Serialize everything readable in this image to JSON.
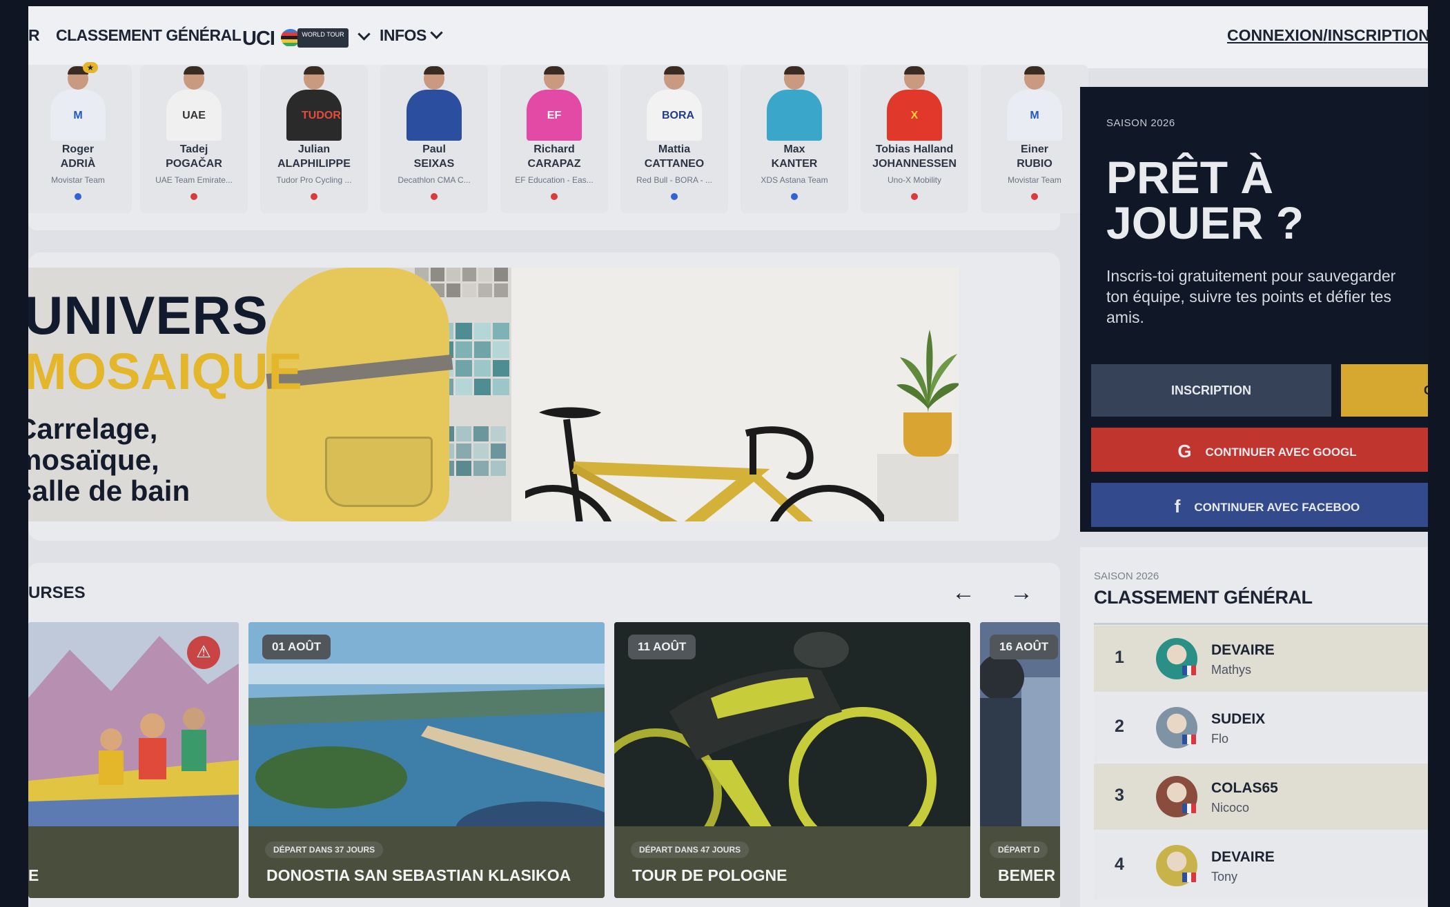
{
  "nav": {
    "partial_item": "R",
    "classement": "CLASSEMENT GÉNÉRAL",
    "uci": "UCI",
    "worldtour": "WORLD TOUR",
    "infos": "INFOS",
    "login": "CONNEXION",
    "login_sep": "/",
    "register": "INSCRIPTION"
  },
  "riders": [
    {
      "first": "Roger",
      "last": "ADRIÀ",
      "team": "Movistar Team",
      "dot": "#2f63d6",
      "kit": "#e9ecf2",
      "logo": "M",
      "logo_color": "#1f58c7",
      "star": "★"
    },
    {
      "first": "Tadej",
      "last": "POGAČAR",
      "team": "UAE Team Emirate...",
      "dot": "#d93a3a",
      "kit": "#f0f0f0",
      "logo": "UAE",
      "logo_color": "#333333",
      "star": ""
    },
    {
      "first": "Julian",
      "last": "ALAPHILIPPE",
      "team": "Tudor Pro Cycling ...",
      "dot": "#d93a3a",
      "kit": "#2a2a2a",
      "logo": "TUDOR",
      "logo_color": "#e64b3b",
      "star": ""
    },
    {
      "first": "Paul",
      "last": "SEIXAS",
      "team": "Decathlon CMA C...",
      "dot": "#d93a3a",
      "kit": "#2b4f9e",
      "logo": "",
      "logo_color": "#ffffff",
      "star": ""
    },
    {
      "first": "Richard",
      "last": "CARAPAZ",
      "team": "EF Education - Eas...",
      "dot": "#d93a3a",
      "kit": "#e24aa5",
      "logo": "EF",
      "logo_color": "#ffffff",
      "star": ""
    },
    {
      "first": "Mattia",
      "last": "CATTANEO",
      "team": "Red Bull - BORA - ...",
      "dot": "#2f63d6",
      "kit": "#f2f2f2",
      "logo": "BORA",
      "logo_color": "#1f3d8a",
      "star": ""
    },
    {
      "first": "Max",
      "last": "KANTER",
      "team": "XDS Astana Team",
      "dot": "#2f63d6",
      "kit": "#3aa6c9",
      "logo": "",
      "logo_color": "#ffffff",
      "star": ""
    },
    {
      "first": "Tobias Halland",
      "last": "JOHANNESSEN",
      "team": "Uno-X Mobility",
      "dot": "#d93a3a",
      "kit": "#e0392c",
      "logo": "X",
      "logo_color": "#f4d23a",
      "star": ""
    },
    {
      "first": "Einer",
      "last": "RUBIO",
      "team": "Movistar Team",
      "dot": "#d93a3a",
      "kit": "#e9ecf2",
      "logo": "M",
      "logo_color": "#1f58c7",
      "star": ""
    }
  ],
  "ad": {
    "title_1": "UNIVERS",
    "title_2": "MOSAIQUE",
    "line_1": "Carrelage,",
    "line_2": "mosaïque,",
    "line_3": "salle de bain"
  },
  "races": {
    "title": "URSES",
    "prev": "←",
    "next": "→",
    "items": [
      {
        "date": "",
        "depart": "",
        "name": "E",
        "warn": "⚠"
      },
      {
        "date": "01 AOÛT",
        "depart": "DÉPART DANS 37 JOURS",
        "name": "DONOSTIA SAN SEBASTIAN KLASIKOA",
        "warn": ""
      },
      {
        "date": "11 AOÛT",
        "depart": "DÉPART DANS 47 JOURS",
        "name": "TOUR DE POLOGNE",
        "warn": ""
      },
      {
        "date": "16 AOÛT",
        "depart": "DÉPART D",
        "name": "BEMER",
        "warn": ""
      }
    ]
  },
  "signup": {
    "season": "SAISON 2026",
    "title_1": "PRÊT À",
    "title_2": "JOUER ?",
    "text": "Inscris-toi gratuitement pour sauvegarder ton équipe, suivre tes points et défier tes amis.",
    "btn_inscription": "INSCRIPTION",
    "btn_yellow": "C",
    "google_icon": "G",
    "btn_google": "CONTINUER AVEC GOOGL",
    "fb_icon": "f",
    "btn_facebook": "CONTINUER AVEC FACEBOO"
  },
  "ranking": {
    "season": "SAISON 2026",
    "title": "CLASSEMENT GÉNÉRAL",
    "rows": [
      {
        "rank": "1",
        "name": "DEVAIRE",
        "sub": "Mathys",
        "bg": "#e0ddd3",
        "avatar": "#2a8f86"
      },
      {
        "rank": "2",
        "name": "SUDEIX",
        "sub": "Flo",
        "bg": "#e6e8ec",
        "avatar": "#7f93a4"
      },
      {
        "rank": "3",
        "name": "COLAS65",
        "sub": "Nicoco",
        "bg": "#e0ddd3",
        "avatar": "#8a4c3c"
      },
      {
        "rank": "4",
        "name": "DEVAIRE",
        "sub": "Tony",
        "bg": "#e6e8ec",
        "avatar": "#c8b24a"
      }
    ]
  }
}
